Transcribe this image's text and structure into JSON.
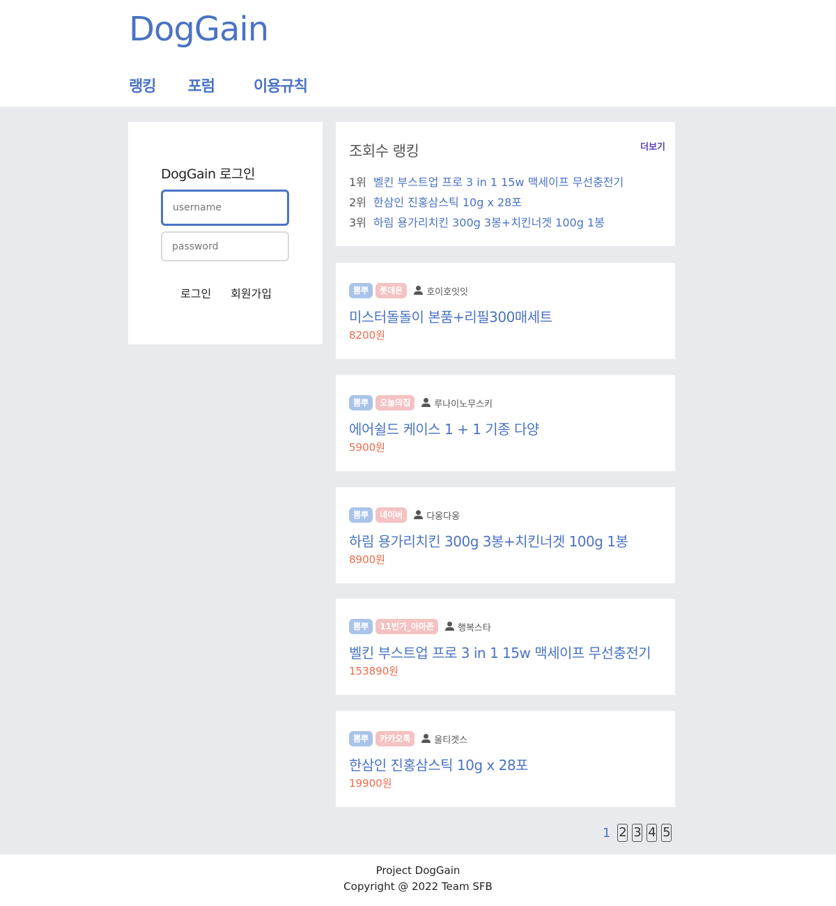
{
  "brand": "DogGain",
  "nav": [
    "랭킹",
    "포럼",
    "이용규칙"
  ],
  "login": {
    "title": "DogGain 로그인",
    "username_placeholder": "username",
    "password_placeholder": "password",
    "login_label": "로그인",
    "signup_label": "회원가입"
  },
  "ranking": {
    "title": "조회수 랭킹",
    "more_label": "더보기",
    "items": [
      {
        "rank": "1위",
        "name": "벨킨 부스트업 프로 3 in 1 15w 맥세이프 무선충전기"
      },
      {
        "rank": "2위",
        "name": "한삼인 진홍삼스틱 10g x 28포"
      },
      {
        "rank": "3위",
        "name": "하림 용가리치킨 300g 3봉+치킨너겟 100g 1봉"
      }
    ]
  },
  "posts": [
    {
      "category": "뽐뿌",
      "shop": "롯데온",
      "author": "호이호잇잇",
      "title": "미스터돌돌이 본품+리필300매세트",
      "price": "8200원"
    },
    {
      "category": "뽐뿌",
      "shop": "오늘의집",
      "author": "루나이노무스키",
      "title": "에어쉴드 케이스 1 + 1 기종 다양",
      "price": "5900원"
    },
    {
      "category": "뽐뿌",
      "shop": "네이버",
      "author": "다옹다옹",
      "title": "하림 용가리치킨 300g 3봉+치킨너겟 100g 1봉",
      "price": "8900원"
    },
    {
      "category": "뽐뿌",
      "shop": "11번가_아마존",
      "author": "행복스타",
      "title": "벨킨 부스트업 프로 3 in 1 15w 맥세이프 무선충전기",
      "price": "153890원"
    },
    {
      "category": "뽐뿌",
      "shop": "카카오톡",
      "author": "울티겟스",
      "title": "한삼인 진홍삼스틱 10g x 28포",
      "price": "19900원"
    }
  ],
  "pagination": {
    "current": "1",
    "pages": [
      "2",
      "3",
      "4",
      "5"
    ]
  },
  "footer": {
    "line1": "Project DogGain",
    "line2": "Copyright @ 2022 Team SFB"
  },
  "colors": {
    "accent": "#4a73c4",
    "price": "#ef6a4a",
    "background": "#e9eaee",
    "category_badge": "#a9c3ea",
    "shop_badge": "#f4c2c2"
  }
}
